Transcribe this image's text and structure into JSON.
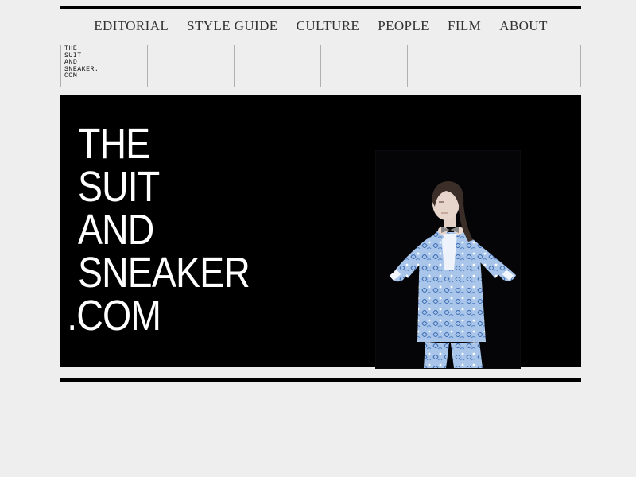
{
  "nav": {
    "items": [
      "EDITORIAL",
      "STYLE GUIDE",
      "CULTURE",
      "PEOPLE",
      "FILM",
      "ABOUT"
    ]
  },
  "small_logo": {
    "lines": [
      "THE",
      "SUIT",
      "AND",
      "SNEAKER.",
      "COM"
    ]
  },
  "hero": {
    "logo_lines": [
      "THE",
      "SUIT",
      "AND",
      "SNEAKER",
      ".COM"
    ]
  },
  "colors": {
    "background": "#eeeeee",
    "hero_bg": "#000000",
    "suit_blue": "#9fbfe6"
  }
}
